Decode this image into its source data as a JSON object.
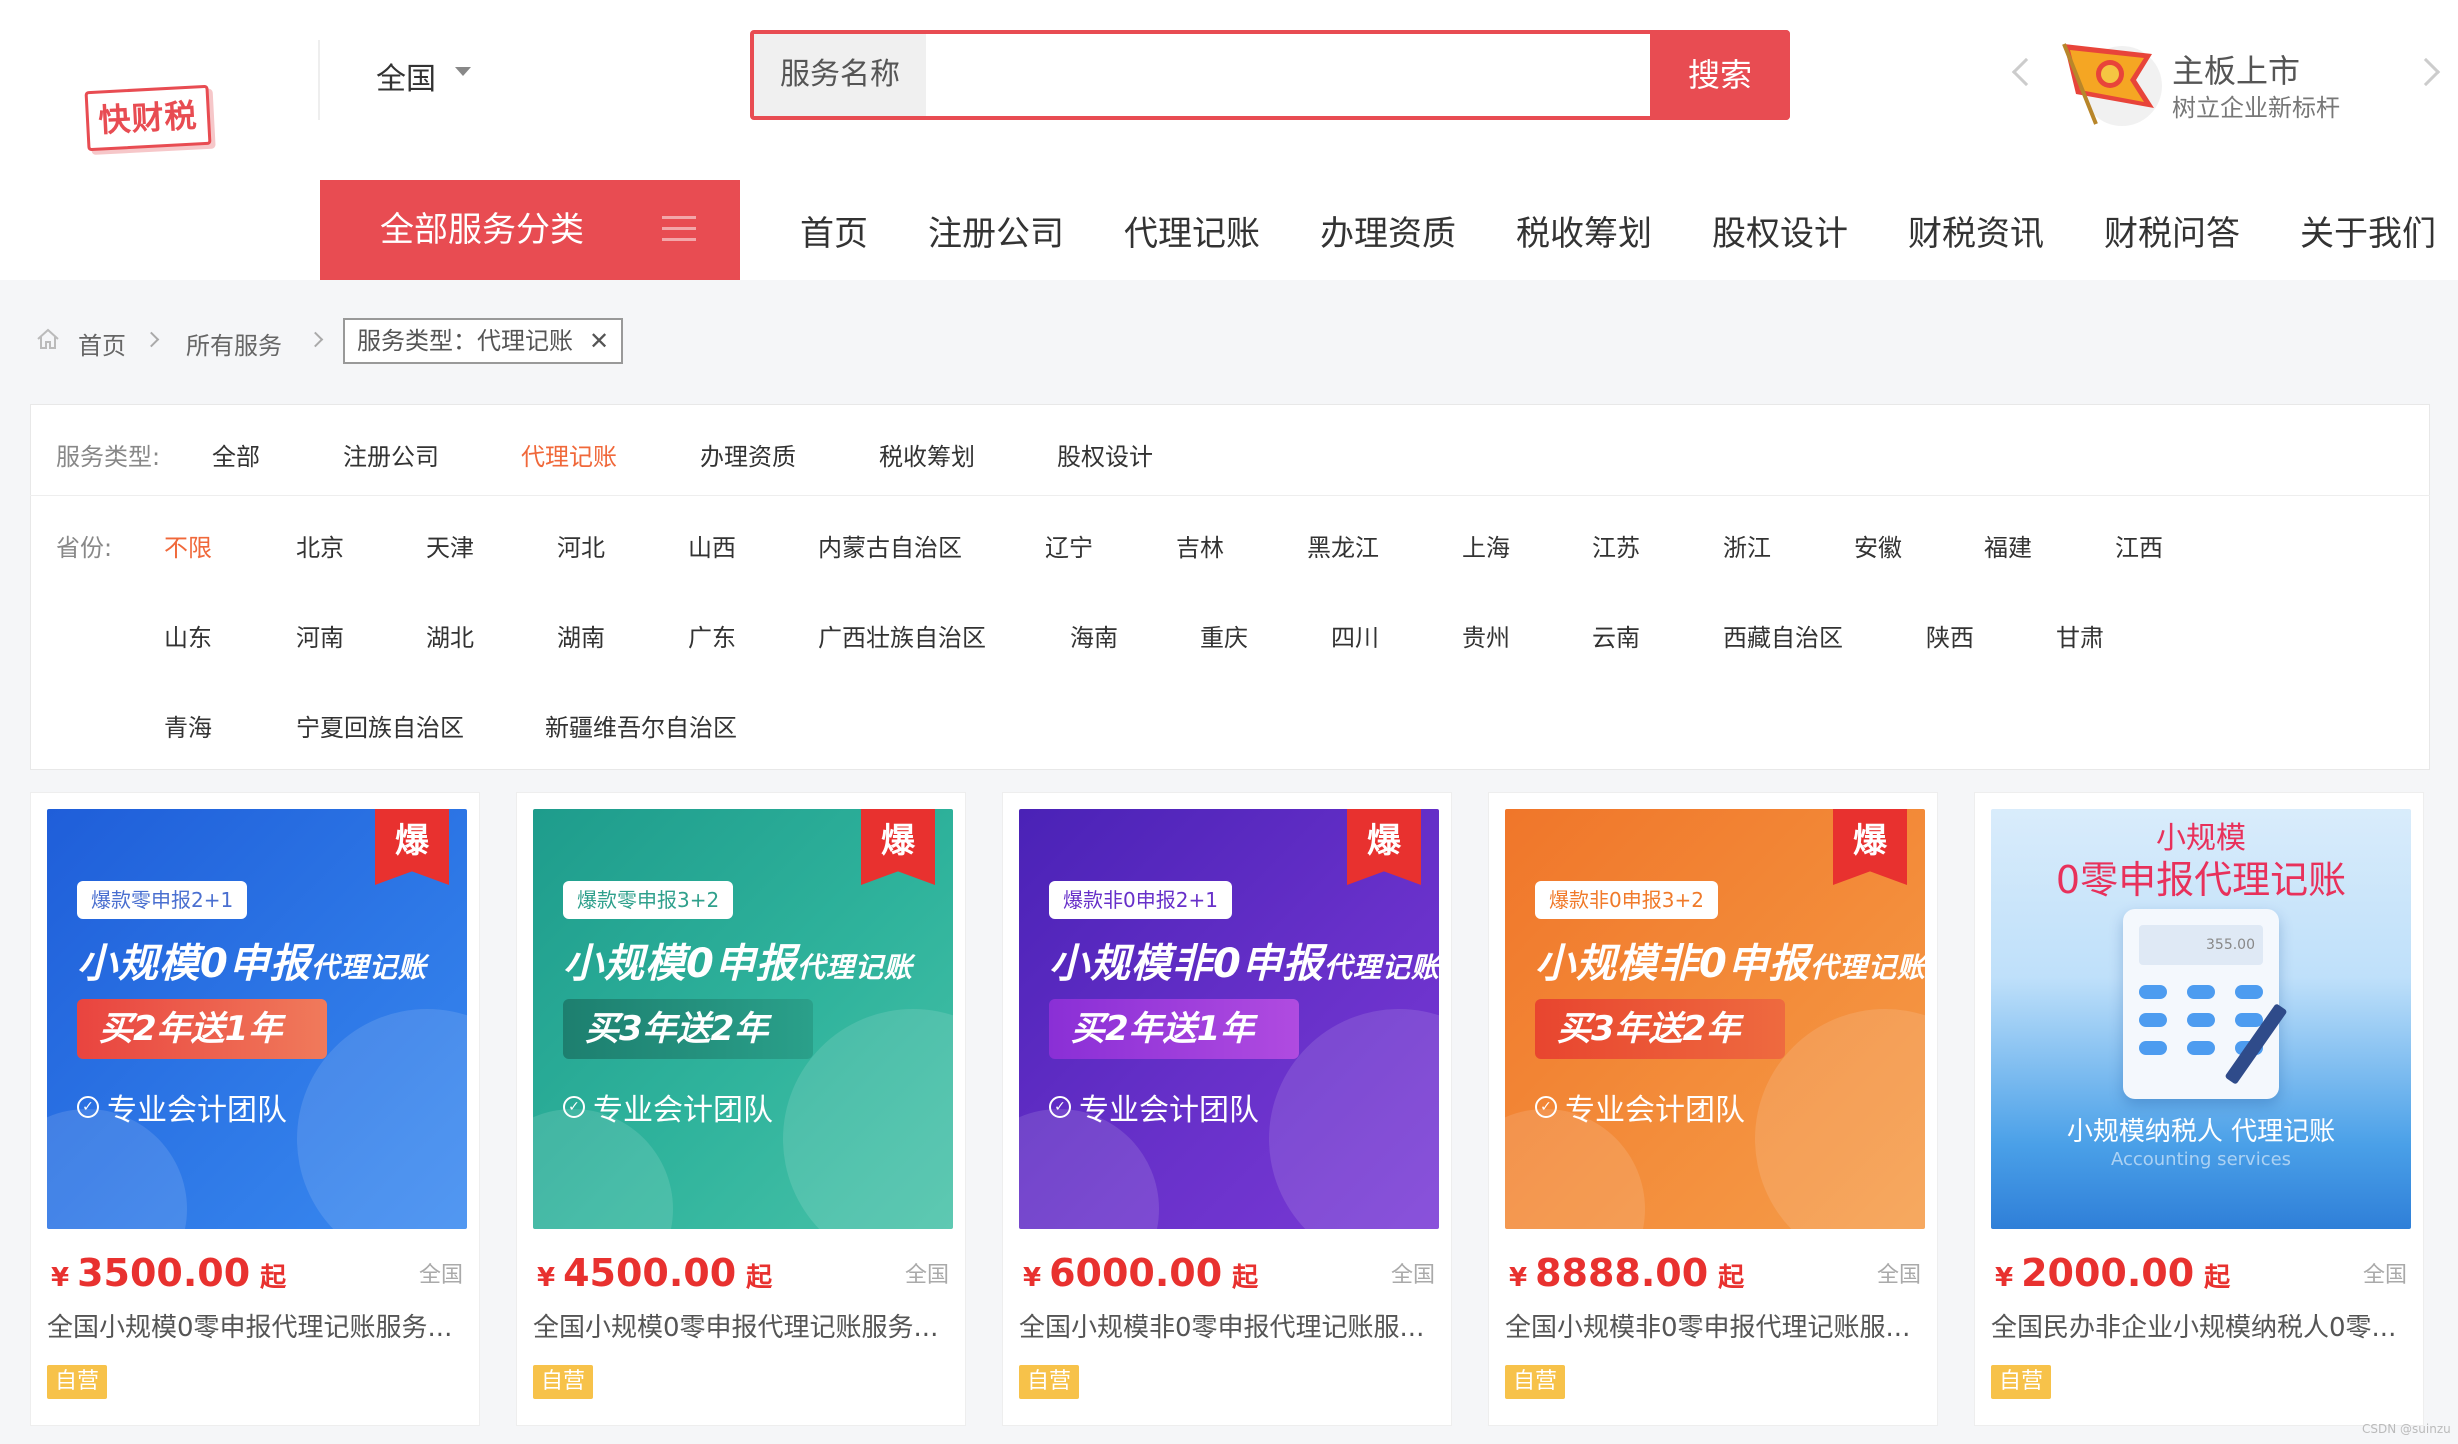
{
  "logo_text": "快财税",
  "region": "全国",
  "search": {
    "type_label": "服务名称",
    "value": "",
    "placeholder": "",
    "button": "搜索"
  },
  "promo": {
    "title": "主板上市",
    "subtitle": "树立企业新标杆"
  },
  "category_button": "全部服务分类",
  "nav": [
    "首页",
    "注册公司",
    "代理记账",
    "办理资质",
    "税收筹划",
    "股权设计",
    "财税资讯",
    "财税问答",
    "关于我们"
  ],
  "breadcrumb": {
    "home": "首页",
    "all": "所有服务",
    "tag": "服务类型：代理记账",
    "close": "✕"
  },
  "filters": {
    "service_type_label": "服务类型:",
    "service_types": [
      "全部",
      "注册公司",
      "代理记账",
      "办理资质",
      "税收筹划",
      "股权设计"
    ],
    "service_active": "代理记账",
    "province_label": "省份:",
    "province_rows": [
      [
        "不限",
        "北京",
        "天津",
        "河北",
        "山西",
        "内蒙古自治区",
        "辽宁",
        "吉林",
        "黑龙江",
        "上海",
        "江苏",
        "浙江",
        "安徽",
        "福建",
        "江西"
      ],
      [
        "山东",
        "河南",
        "湖北",
        "湖南",
        "广东",
        "广西壮族自治区",
        "海南",
        "重庆",
        "四川",
        "贵州",
        "云南",
        "西藏自治区",
        "陕西",
        "甘肃"
      ],
      [
        "青海",
        "宁夏回族自治区",
        "新疆维吾尔自治区"
      ]
    ],
    "province_active": "不限"
  },
  "cards": [
    {
      "hot": "爆",
      "pill": "爆款零申报2+1",
      "headline": "小规模0申报",
      "headline_small": "代理记账",
      "banner": "买2年送1年",
      "feature": "专业会计团队",
      "currency": "¥",
      "price": "3500.00",
      "suffix": "起",
      "region": "全国",
      "title": "全国小规模0零申报代理记账服务...",
      "badge": "自营"
    },
    {
      "hot": "爆",
      "pill": "爆款零申报3+2",
      "headline": "小规模0申报",
      "headline_small": "代理记账",
      "banner": "买3年送2年",
      "feature": "专业会计团队",
      "currency": "¥",
      "price": "4500.00",
      "suffix": "起",
      "region": "全国",
      "title": "全国小规模0零申报代理记账服务...",
      "badge": "自营"
    },
    {
      "hot": "爆",
      "pill": "爆款非0申报2+1",
      "headline": "小规模非0申报",
      "headline_small": "代理记账",
      "banner": "买2年送1年",
      "feature": "专业会计团队",
      "currency": "¥",
      "price": "6000.00",
      "suffix": "起",
      "region": "全国",
      "title": "全国小规模非0零申报代理记账服...",
      "badge": "自营"
    },
    {
      "hot": "爆",
      "pill": "爆款非0申报3+2",
      "headline": "小规模非0申报",
      "headline_small": "代理记账",
      "banner": "买3年送2年",
      "feature": "专业会计团队",
      "currency": "¥",
      "price": "8888.00",
      "suffix": "起",
      "region": "全国",
      "title": "全国小规模非0零申报代理记账服...",
      "badge": "自营"
    },
    {
      "top1": "小规模",
      "top2": "0零申报代理记账",
      "screen": "355.00",
      "bottom1": "小规模纳税人 代理记账",
      "bottom2": "Accounting services",
      "currency": "¥",
      "price": "2000.00",
      "suffix": "起",
      "region": "全国",
      "title": "全国民办非企业小规模纳税人0零...",
      "badge": "自营"
    }
  ],
  "watermark": "CSDN @suinzu"
}
